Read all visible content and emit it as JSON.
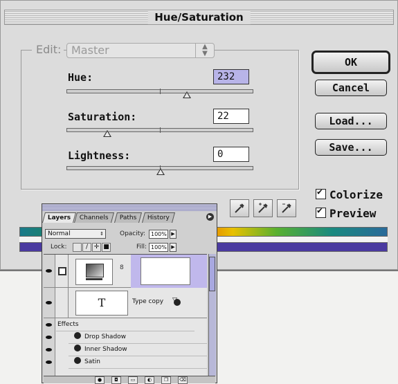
{
  "dialog": {
    "title": "Hue/Saturation",
    "edit_label": "Edit:",
    "edit_value": "Master",
    "hue": {
      "label": "Hue:",
      "value": "232"
    },
    "saturation": {
      "label": "Saturation:",
      "value": "22"
    },
    "lightness": {
      "label": "Lightness:",
      "value": "0"
    },
    "buttons": {
      "ok": "OK",
      "cancel": "Cancel",
      "load": "Load...",
      "save": "Save..."
    },
    "colorize": {
      "label": "Colorize",
      "checked": true
    },
    "preview": {
      "label": "Preview",
      "checked": true
    },
    "result_color": "#4a3aa0"
  },
  "layers_palette": {
    "tabs": [
      "Layers",
      "Channels",
      "Paths",
      "History"
    ],
    "blend_mode": "Normal",
    "opacity_label": "Opacity:",
    "opacity_value": "100%",
    "lock_label": "Lock:",
    "fill_label": "Fill:",
    "fill_value": "100%",
    "type_layer_thumb": "T",
    "type_layer_name": "Type copy",
    "effects_label": "Effects",
    "effects": [
      "Drop Shadow",
      "Inner Shadow",
      "Satin"
    ]
  }
}
